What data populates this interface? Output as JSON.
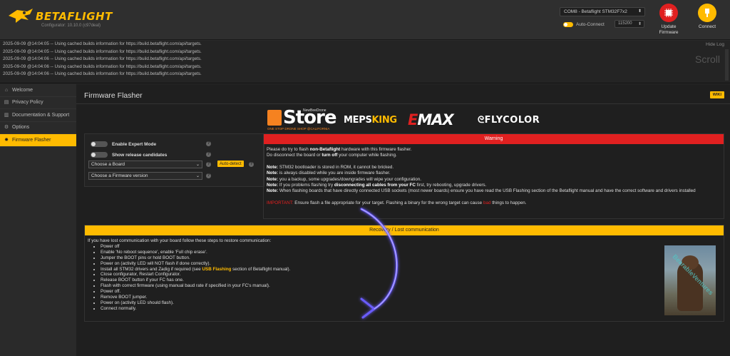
{
  "header": {
    "brand": "BETAFLIGHT",
    "version": "Configurator: 10.10.0 (c97deal)",
    "port": "COM8 - Betaflight STM32F7x2",
    "auto_connect": "Auto-Connect",
    "baud": "115200",
    "update_firmware": "Update Firmware",
    "connect": "Connect"
  },
  "log": {
    "hide": "Hide Log",
    "scroll": "Scroll",
    "lines": [
      "2025-09-09 @14:04:05 -- Using cached builds information for https://build.betaflight.com/api/targets.",
      "2025-09-09 @14:04:05 -- Using cached builds information for https://build.betaflight.com/api/targets.",
      "2025-09-09 @14:04:06 -- Using cached builds information for https://build.betaflight.com/api/targets.",
      "2025-09-09 @14:04:06 -- Using cached builds information for https://build.betaflight.com/api/targets.",
      "2025-09-09 @14:04:06 -- Using cached builds information for https://build.betaflight.com/api/targets."
    ]
  },
  "sidebar": {
    "items": [
      {
        "label": "Welcome",
        "icon": "home-icon"
      },
      {
        "label": "Privacy Policy",
        "icon": "document-icon"
      },
      {
        "label": "Documentation & Support",
        "icon": "book-icon"
      },
      {
        "label": "Options",
        "icon": "gear-icon"
      },
      {
        "label": "Firmware Flasher",
        "icon": "flash-icon"
      }
    ]
  },
  "main": {
    "title": "Firmware Flasher",
    "wiki": "WIKI"
  },
  "sponsors": {
    "store": "Store",
    "store_top": "NewBeeDrone",
    "store_sub": "ONE STOP DRONE SHOP @CALIFORNIA",
    "meps_a": "MEPS",
    "meps_b": "KING",
    "emax_a": "E",
    "emax_b": "MAX",
    "flycolor": "FLYCOLOR"
  },
  "options": {
    "expert_mode": "Enable Expert Mode",
    "release_candidates": "Show release candidates",
    "board": "Choose a Board",
    "auto_detect": "Auto-detect",
    "firmware": "Choose a Firmware version"
  },
  "warning": {
    "title": "Warning",
    "l1_a": "Please do ",
    "l1_b": "try to flash ",
    "l1_c": "non-Betaflight",
    "l1_d": " hardware with this firmware flasher.",
    "l2_a": "Do ",
    "l2_b": "disconnect the board or ",
    "l2_c": "turn off",
    "l2_d": " your computer while flashing.",
    "note_label": "Note:",
    "l3": " STM32 bootloader is stored in ROM, it cannot be bricked.",
    "l4": " is always disabled while you are inside firmware flasher.",
    "l5": " you a backup, some upgrades/downgrades will wipe your configuration.",
    "l6_a": " If you ",
    "l6_b": " problems flashing try ",
    "l6_c": "disconnecting all cables from your FC",
    "l6_d": " first, try rebooting, upgrade drivers.",
    "l7": " When flashing boards that have directly connected USB sockets (most newer boards) ensure you have read the USB Flashing section of the Betaflight manual and have the correct software and drivers installed",
    "important_label": "IMPORTANT:",
    "l8_a": " Ensure ",
    "l8_b": " flash a file appropriate for your target. Flashing a binary for the wrong target can cause ",
    "l8_bad": "bad",
    "l8_c": " things to happen."
  },
  "recovery": {
    "title": "Recovery / Lost communication",
    "intro": "If you have lost communication with your board follow these steps to restore communication:",
    "steps": [
      "Power off",
      "Enable 'No reboot sequence', enable 'Full chip erase'.",
      "Jumper the BOOT pins or hold BOOT button.",
      "Power on (activity LED will NOT flash if done correctly).",
      "Close configurator, Restart Configurator.",
      "Release BOOT button if your FC has one.",
      "Flash with correct firmware (using manual baud rate if specified in your FC's manual).",
      "Power off.",
      "Remove BOOT jumper.",
      "Power on (activity LED should flash).",
      "Connect normally."
    ],
    "install_a": "Install all STM32 drivers and Zadig if required (see ",
    "install_link": "USB Flashing",
    "install_b": " section of Betaflight manual).",
    "watermark": "BearableVentures"
  },
  "colors": {
    "accent": "#ffbb00",
    "warning": "#e02020",
    "background": "#1f1f1f"
  }
}
